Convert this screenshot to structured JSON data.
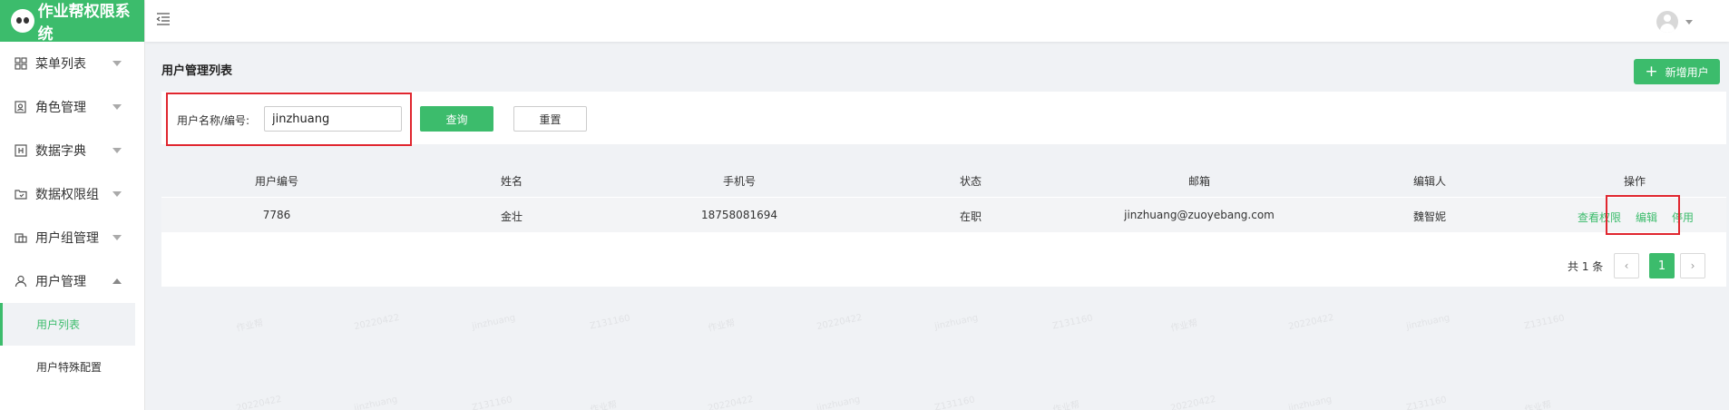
{
  "app": {
    "title": "作业帮权限系统"
  },
  "sidebar": {
    "items": [
      {
        "label": "菜单列表",
        "icon": "grid-icon"
      },
      {
        "label": "角色管理",
        "icon": "role-icon"
      },
      {
        "label": "数据字典",
        "icon": "dictionary-icon"
      },
      {
        "label": "数据权限组",
        "icon": "folder-icon"
      },
      {
        "label": "用户组管理",
        "icon": "group-icon"
      },
      {
        "label": "用户管理",
        "icon": "user-icon",
        "expanded": true
      }
    ],
    "sub_items": [
      {
        "label": "用户列表",
        "active": true
      },
      {
        "label": "用户特殊配置",
        "active": false
      }
    ]
  },
  "page": {
    "title": "用户管理列表",
    "add_button": "新增用户"
  },
  "search": {
    "label": "用户名称/编号:",
    "value": "jinzhuang",
    "query_button": "查询",
    "reset_button": "重置"
  },
  "table": {
    "headers": [
      "用户编号",
      "姓名",
      "手机号",
      "状态",
      "邮箱",
      "编辑人",
      "操作"
    ],
    "rows": [
      {
        "cells": [
          "7786",
          "金壮",
          "18758081694",
          "在职",
          "jinzhuang@zuoyebang.com",
          "魏智妮"
        ],
        "actions": [
          "查看权限",
          "编辑",
          "停用"
        ]
      }
    ]
  },
  "pagination": {
    "total_text": "共 1 条",
    "current_page": "1"
  },
  "watermark": {
    "texts": [
      "20220422",
      "jinzhuang",
      "Z131160",
      "作业帮"
    ]
  },
  "colors": {
    "brand": "#3cbc6c",
    "highlight": "#e0262f"
  }
}
